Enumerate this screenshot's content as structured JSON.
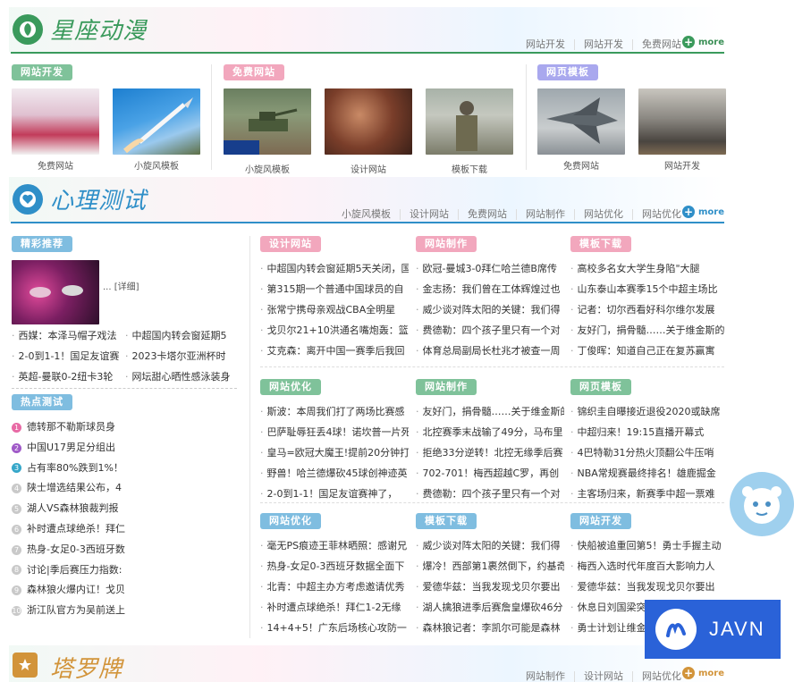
{
  "colors": {
    "green": "#3a9a5c",
    "blue": "#2f8fc8",
    "orange": "#d2943a",
    "pink": "#f2a7bd",
    "purple": "#a9a8ee"
  },
  "section1": {
    "title": "星座动漫",
    "links": [
      "网站开发",
      "网站开发",
      "免费网站"
    ],
    "more": "more",
    "groups": [
      {
        "badge": "网站开发",
        "items": [
          {
            "caption": "免费网站",
            "icon": "stage-performance-photo"
          },
          {
            "caption": "小旋风模板",
            "icon": "rocket-launch-photo"
          }
        ]
      },
      {
        "badge": "免费网站",
        "items": [
          {
            "caption": "小旋风模板",
            "icon": "tank-photo"
          },
          {
            "caption": "设计网站",
            "icon": "crowd-photo"
          },
          {
            "caption": "模板下载",
            "icon": "soldier-photo"
          }
        ]
      },
      {
        "badge": "网页模板",
        "items": [
          {
            "caption": "免费网站",
            "icon": "stealth-jet-photo"
          },
          {
            "caption": "网站开发",
            "icon": "smoke-photo"
          }
        ]
      }
    ]
  },
  "section2": {
    "title": "心理测试",
    "links": [
      "小旋风模板",
      "设计网站",
      "免费网站",
      "网站制作",
      "网站优化",
      "网站优化"
    ],
    "more": "more",
    "featured": {
      "badge": "精彩推荐",
      "detail": "... [详细]",
      "lines": [
        [
          "西媒：本泽马帽子戏法",
          "中超国内转会窗延期5"
        ],
        [
          "2-0到1-1！国足友谊赛",
          "2023卡塔尔亚洲杯时"
        ],
        [
          "英超-曼联0-2纽卡3轮",
          "网坛甜心晒性感泳装身"
        ]
      ]
    },
    "hot": {
      "badge": "热点测试",
      "items": [
        {
          "n": "1",
          "text": "德转那不勒斯球员身"
        },
        {
          "n": "2",
          "text": "中国U17男足分组出"
        },
        {
          "n": "3",
          "text": "占有率80%跌到1%！"
        },
        {
          "n": "4",
          "text": "陕士增选结果公布，4"
        },
        {
          "n": "5",
          "text": "湖人VS森林狼裁判报"
        },
        {
          "n": "6",
          "text": "补时遭点球绝杀！拜仁"
        },
        {
          "n": "7",
          "text": "热身-女足0-3西班牙数"
        },
        {
          "n": "8",
          "text": "讨论|季后赛压力指数:"
        },
        {
          "n": "9",
          "text": "森林狼火爆内讧！戈贝"
        },
        {
          "n": "10",
          "text": "浙江队官方为吴前送上"
        }
      ]
    },
    "blocks": [
      {
        "badge": "设计网站",
        "items": [
          "中超国内转会窗延期5天关闭，国",
          "第315期一个普通中国球员的自",
          "张常宁携母亲观战CBA全明星",
          "戈贝尔21+10洪通名嘴炮轰：篮",
          "艾克森：离开中国一赛季后我回"
        ]
      },
      {
        "badge": "网站制作",
        "items": [
          "欧冠-曼城3-0拜仁哈兰德B席传",
          "金志扬：我们曾在工体辉煌过也",
          "威少谈对阵太阳的关键：我们得",
          "费德勒：四个孩子里只有一个对",
          "体育总局副局长杜兆才被查一周"
        ]
      },
      {
        "badge": "模板下载",
        "items": [
          "高校多名女大学生身陷\"大腿",
          "山东泰山本赛季15个中超主场比",
          "记者：切尔西看好科尔维尔发展",
          "友好门，捐骨髓……关于维金斯的",
          "丁俊晖：知道自己正在复苏赢寓"
        ]
      },
      {
        "badge": "网站优化",
        "items": [
          "斯波：本周我们打了两场比赛感",
          "巴萨耻辱狂丢4球！诺坎普一片死",
          "皇马=欧冠大魔王!提前20分钟打",
          "野兽！哈兰德爆砍45球创神迹英",
          "2-0到1-1！国足友谊赛神了，"
        ]
      },
      {
        "badge": "网站制作",
        "items": [
          "友好门，捐骨髓……关于维金斯的",
          "北控赛季末战输了49分，马布里",
          "拒绝33分逆转！北控无缘季后赛",
          "702-701！梅西超越C罗，再创",
          "费德勒：四个孩子里只有一个对"
        ]
      },
      {
        "badge": "网页模板",
        "items": [
          "锦织圭自曝接近退役2020或缺席",
          "中超归来！19:15直播开幕式",
          "4巴特勒31分热火顶翻公牛压哨",
          "NBA常规赛最终排名！雄鹿掘金",
          "主客场归来，新赛季中超一票难"
        ]
      },
      {
        "badge": "网站优化",
        "items": [
          "毫无PS痕迹王菲林晒照：感谢兄",
          "热身-女足0-3西班牙数据全面下",
          "北青：中超主办方考虑邀请优秀",
          "补时遭点球绝杀！拜仁1-2无缘",
          "14+4+5！广东后场核心攻防一"
        ]
      },
      {
        "badge": "模板下载",
        "items": [
          "威少谈对阵太阳的关键：我们得",
          "爆冷！西部第1裹然倒下，约基奇",
          "爱德华兹：当我发现戈贝尔要出",
          "湖人擒狼进季后赛詹皇爆砍46分",
          "森林狼记者：李凯尔可能是森林"
        ]
      },
      {
        "badge": "网站开发",
        "items": [
          "快船被追重回第5！勇士手握主动",
          "梅西入选时代年度百大影响力人",
          "爱德华兹：当我发现戈贝尔要出",
          "休息日刘国梁突...",
          "勇士计划让维金..."
        ]
      }
    ]
  },
  "section3": {
    "title": "塔罗牌",
    "links": [
      "网站制作",
      "设计网站",
      "网站优化"
    ],
    "more": "more"
  },
  "overlay": {
    "brand": "JAVN"
  }
}
